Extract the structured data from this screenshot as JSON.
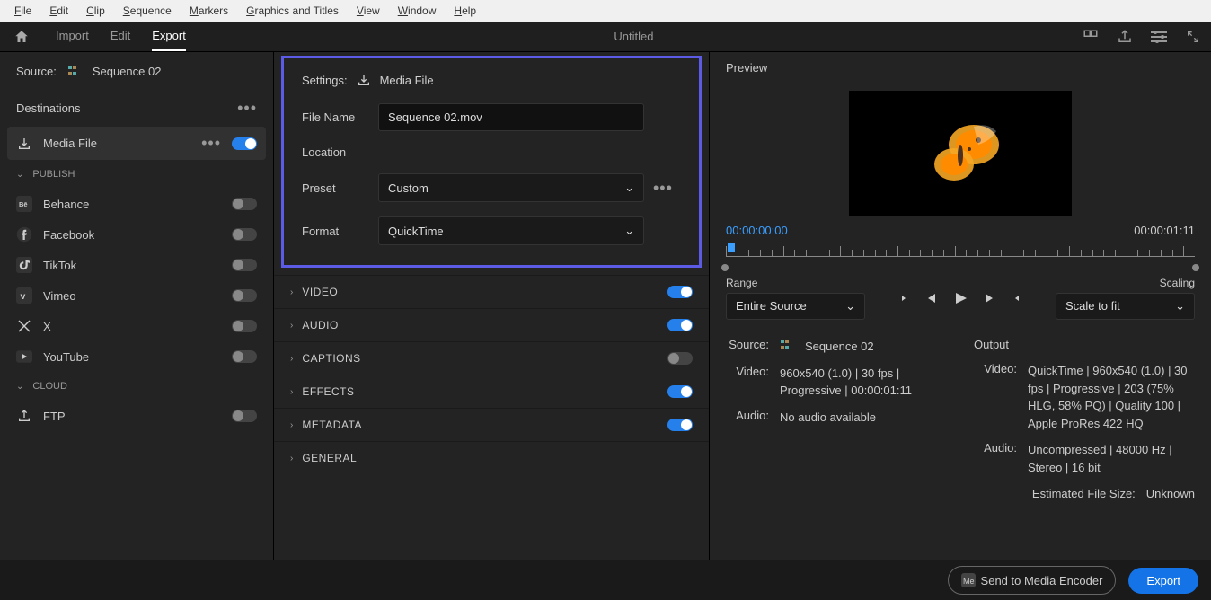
{
  "menubar": [
    "File",
    "Edit",
    "Clip",
    "Sequence",
    "Markers",
    "Graphics and Titles",
    "View",
    "Window",
    "Help"
  ],
  "toolbar": {
    "tabs": {
      "import": "Import",
      "edit": "Edit",
      "export": "Export"
    },
    "title": "Untitled"
  },
  "source": {
    "label": "Source:",
    "name": "Sequence 02"
  },
  "destinations": {
    "title": "Destinations",
    "media_file": "Media File",
    "publish_label": "PUBLISH",
    "items": [
      {
        "icon": "behance",
        "label": "Behance"
      },
      {
        "icon": "facebook",
        "label": "Facebook"
      },
      {
        "icon": "tiktok",
        "label": "TikTok"
      },
      {
        "icon": "vimeo",
        "label": "Vimeo"
      },
      {
        "icon": "x",
        "label": "X"
      },
      {
        "icon": "youtube",
        "label": "YouTube"
      }
    ],
    "cloud_label": "CLOUD",
    "ftp": "FTP"
  },
  "settings": {
    "title": "Settings:",
    "media_file": "Media File",
    "file_name_label": "File Name",
    "file_name_value": "Sequence 02.mov",
    "location_label": "Location",
    "preset_label": "Preset",
    "preset_value": "Custom",
    "format_label": "Format",
    "format_value": "QuickTime"
  },
  "sections": {
    "video": "VIDEO",
    "audio": "AUDIO",
    "captions": "CAPTIONS",
    "effects": "EFFECTS",
    "metadata": "METADATA",
    "general": "GENERAL"
  },
  "preview": {
    "title": "Preview",
    "tc_start": "00:00:00:00",
    "tc_end": "00:00:01:11",
    "range_label": "Range",
    "range_value": "Entire Source",
    "scaling_label": "Scaling",
    "scaling_value": "Scale to fit"
  },
  "summary": {
    "source_label": "Source:",
    "source_name": "Sequence 02",
    "video_label": "Video:",
    "video_value": "960x540 (1.0) | 30 fps | Progressive | 00:00:01:11",
    "audio_label": "Audio:",
    "audio_value": "No audio available",
    "output_title": "Output",
    "out_video_label": "Video:",
    "out_video_value": "QuickTime | 960x540 (1.0) | 30 fps | Progressive | 203 (75% HLG, 58% PQ) | Quality 100 | Apple ProRes 422 HQ",
    "out_audio_label": "Audio:",
    "out_audio_value": "Uncompressed | 48000 Hz | Stereo | 16 bit",
    "est_label": "Estimated File Size:",
    "est_value": "Unknown"
  },
  "bottom": {
    "encoder": "Send to Media Encoder",
    "export": "Export"
  }
}
